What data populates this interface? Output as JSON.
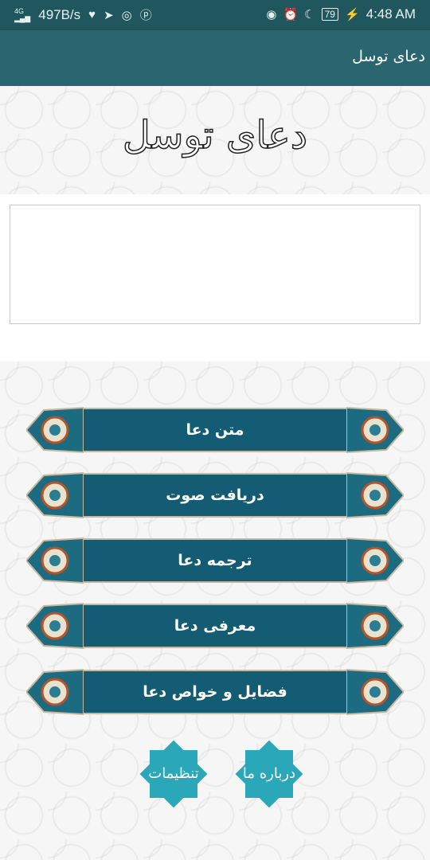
{
  "status_bar": {
    "signal": "4G",
    "speed": "497B/s",
    "battery": "79",
    "time": "4:48 AM"
  },
  "app_bar": {
    "title": "دعای توسل"
  },
  "header": {
    "title": "دعای توسل"
  },
  "menu": [
    {
      "label": "متن دعا"
    },
    {
      "label": "دریافت صوت"
    },
    {
      "label": "ترجمه دعا"
    },
    {
      "label": "معرفی دعا"
    },
    {
      "label": "فضایل و خواص دعا"
    }
  ],
  "bottom_buttons": {
    "about": "درباره ما",
    "settings": "تنظیمات"
  },
  "colors": {
    "app_bar": "#2a6570",
    "status_bar": "#20575f",
    "menu_banner": "#145c73",
    "star": "#2aa7b8"
  },
  "icons": [
    "signal-icon",
    "heartbeat-icon",
    "telegram-icon",
    "instagram-icon",
    "pinterest-icon",
    "eye-icon",
    "alarm-icon",
    "moon-icon",
    "battery-icon",
    "charging-icon"
  ]
}
